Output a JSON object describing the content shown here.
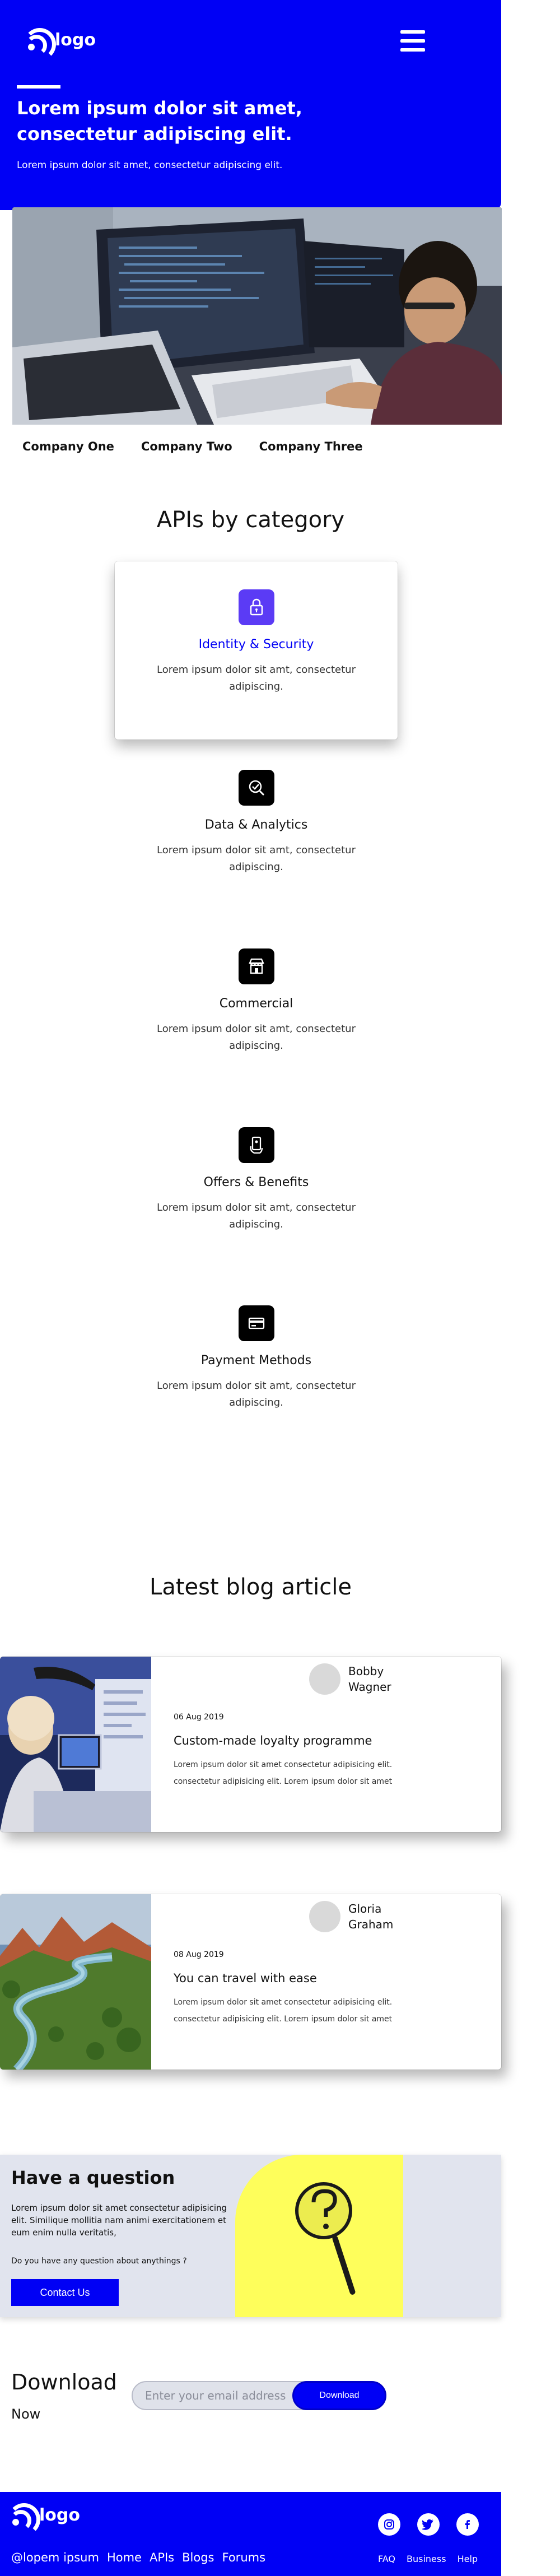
{
  "header": {
    "logo_text": "logo",
    "title": "Lorem ipsum dolor sit amet, consectetur adipiscing elit.",
    "subtitle": "Lorem ipsum dolor sit amet, consectetur adipiscing elit."
  },
  "companies": [
    "Company One",
    "Company Two",
    "Company Three"
  ],
  "categories_section": {
    "title": "APIs by category",
    "items": [
      {
        "name": "Identity & Security",
        "desc": "Lorem ipsum dolor sit amt, consectetur adipiscing.",
        "icon": "lock-icon"
      },
      {
        "name": "Data & Analytics",
        "desc": "Lorem ipsum dolor sit amt, consectetur adipiscing.",
        "icon": "analytics-icon"
      },
      {
        "name": "Commercial",
        "desc": "Lorem ipsum dolor sit amt, consectetur adipiscing.",
        "icon": "store-icon"
      },
      {
        "name": "Offers & Benefits",
        "desc": "Lorem ipsum dolor sit amt, consectetur adipiscing.",
        "icon": "offers-icon"
      },
      {
        "name": "Payment Methods",
        "desc": "Lorem ipsum dolor sit amt, consectetur adipiscing.",
        "icon": "card-icon"
      }
    ]
  },
  "blog": {
    "title": "Latest blog article",
    "posts": [
      {
        "author": "Bobby Wagner",
        "date": "06 Aug 2019",
        "title": "Custom-made loyalty programme",
        "text": "Lorem ipsum dolor sit amet consectetur adipisicing elit. consectetur adipisicing elit. Lorem ipsum dolor sit amet"
      },
      {
        "author": "Gloria Graham",
        "date": "08 Aug 2019",
        "title": "You can travel with ease",
        "text": "Lorem ipsum dolor sit amet consectetur adipisicing elit. consectetur adipisicing elit. Lorem ipsum dolor sit amet"
      }
    ]
  },
  "question": {
    "title": "Have a question",
    "text": "Lorem ipsum dolor sit amet consectetur adipisicing elit. Similique mollitia nam animi exercitationem et eum enim nulla veritatis,",
    "ask": "Do you have any question about anythings ?",
    "button": "Contact Us"
  },
  "download": {
    "title": "Download",
    "subtitle": "Now",
    "placeholder": "Enter your email address",
    "button": "Download"
  },
  "footer": {
    "logo_text": "logo",
    "nav": [
      "@lopem ipsum",
      "Home",
      "APIs",
      "Blogs",
      "Forums"
    ],
    "links": [
      "FAQ",
      "Business",
      "Help"
    ],
    "social": [
      "instagram-icon",
      "twitter-icon",
      "facebook-icon"
    ]
  },
  "colors": {
    "brand": "#0000f5",
    "accent": "#5b3bf5",
    "highlight": "#fefe5b"
  }
}
